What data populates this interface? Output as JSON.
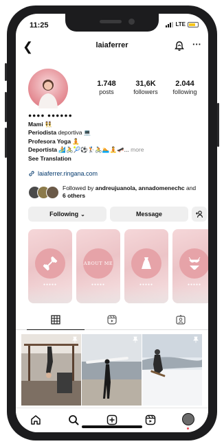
{
  "status_bar": {
    "time": "11:25",
    "network": "LTE"
  },
  "header": {
    "username": "laiaferrer"
  },
  "stats": [
    {
      "number": "1.748",
      "label": "posts"
    },
    {
      "number": "31,6K",
      "label": "followers"
    },
    {
      "number": "2.044",
      "label": "following"
    }
  ],
  "bio": {
    "name_line": "●●●● ●●●●●●",
    "line1": "Mami 👯",
    "line2_bold": "Periodista",
    "line2_rest": " deportiva 💻",
    "line3_bold": "Profesora Yoga",
    "line3_rest": " 🧘",
    "line4_bold": "Deportista",
    "line4_rest": " 🏄🚴🎾⚽🏌🚴🏊🧘🛹... ",
    "more": "more",
    "translation": "See Translation"
  },
  "link": {
    "text": "laiaferrer.ringana.com"
  },
  "followed_by": {
    "prefix": "Followed by ",
    "names": "andreujuanola, annadomenechc",
    "middle": " and ",
    "others": "6 others"
  },
  "buttons": {
    "following": "Following",
    "message": "Message"
  },
  "highlights": [
    {
      "icon": "dumbbell-icon",
      "label": "",
      "dots": "●●●●●"
    },
    {
      "icon": "text-badge",
      "label": "ABOUT ME",
      "dots": "●●●●●"
    },
    {
      "icon": "dress-icon",
      "label": "",
      "dots": "●●●●●"
    },
    {
      "icon": "bikini-icon",
      "label": "",
      "dots": "●●●●●"
    }
  ],
  "colors": {
    "link": "#00376b",
    "highlight_circle": "#e6a3a8",
    "button_bg": "#efefef"
  }
}
